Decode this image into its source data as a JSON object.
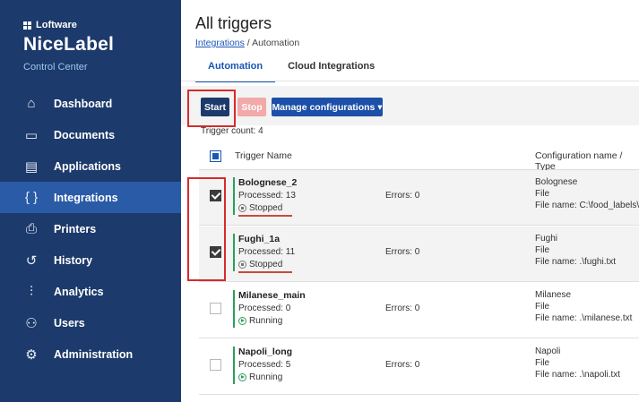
{
  "sidebar": {
    "brand_top": "Loftware",
    "brand_main": "NiceLabel",
    "brand_sub": "Control Center",
    "items": [
      {
        "label": "Dashboard",
        "icon": "home-icon",
        "glyph": "⌂"
      },
      {
        "label": "Documents",
        "icon": "folder-icon",
        "glyph": "▭"
      },
      {
        "label": "Applications",
        "icon": "window-icon",
        "glyph": "▤"
      },
      {
        "label": "Integrations",
        "icon": "braces-icon",
        "glyph": "{ }",
        "active": true
      },
      {
        "label": "Printers",
        "icon": "printer-icon",
        "glyph": "⎙"
      },
      {
        "label": "History",
        "icon": "history-icon",
        "glyph": "↺"
      },
      {
        "label": "Analytics",
        "icon": "analytics-icon",
        "glyph": "⫶"
      },
      {
        "label": "Users",
        "icon": "users-icon",
        "glyph": "⚇"
      },
      {
        "label": "Administration",
        "icon": "gear-icon",
        "glyph": "⚙"
      }
    ]
  },
  "header": {
    "title": "All triggers",
    "breadcrumb_link": "Integrations",
    "breadcrumb_sep": "/",
    "breadcrumb_current": "Automation"
  },
  "tabs": [
    "Automation",
    "Cloud Integrations"
  ],
  "toolbar": {
    "start_label": "Start",
    "stop_label": "Stop",
    "manage_label": "Manage configurations ▾"
  },
  "trigger_count": "Trigger count: 4",
  "table": {
    "col_name": "Trigger Name",
    "col_config": "Configuration name / Type",
    "rows": [
      {
        "name": "Bolognese_2",
        "processed": "Processed: 13",
        "status": "Stopped",
        "errors": "Errors: 0",
        "cfg_name": "Bolognese",
        "cfg_type": "File",
        "cfg_file": "File name: C:\\food_labels\\A",
        "checked": true
      },
      {
        "name": "Fughi_1a",
        "processed": "Processed: 11",
        "status": "Stopped",
        "errors": "Errors: 0",
        "cfg_name": "Fughi",
        "cfg_type": "File",
        "cfg_file": "File name: .\\fughi.txt",
        "checked": true
      },
      {
        "name": "Milanese_main",
        "processed": "Processed: 0",
        "status": "Running",
        "errors": "Errors: 0",
        "cfg_name": "Milanese",
        "cfg_type": "File",
        "cfg_file": "File name: .\\milanese.txt",
        "checked": false
      },
      {
        "name": "Napoli_long",
        "processed": "Processed: 5",
        "status": "Running",
        "errors": "Errors: 0",
        "cfg_name": "Napoli",
        "cfg_type": "File",
        "cfg_file": "File name: .\\napoli.txt",
        "checked": false
      }
    ]
  },
  "colors": {
    "sidebar_bg": "#1c3a6b",
    "active_nav": "#2a5ba6",
    "accent": "#1a56b5",
    "running": "#2aa05a",
    "highlight": "#d62b2b"
  }
}
